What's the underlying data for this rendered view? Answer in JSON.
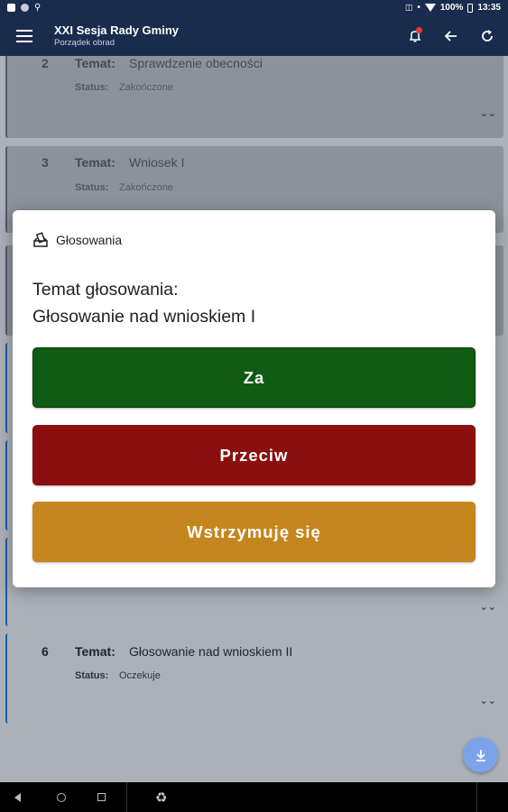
{
  "status_bar": {
    "battery": "100%",
    "time": "13:35"
  },
  "app_bar": {
    "title": "XXI Sesja Rady Gminy",
    "subtitle": "Porządek obrad",
    "icons": [
      "menu-icon",
      "notifications-icon",
      "back-arrow-icon",
      "refresh-icon"
    ]
  },
  "agenda": {
    "items": [
      {
        "number": "2",
        "topic_label": "Temat:",
        "topic": "Sprawdzenie obecności",
        "status_label": "Status:",
        "status": "Zakończone"
      },
      {
        "number": "3",
        "topic_label": "Temat:",
        "topic": "Wniosek I",
        "status_label": "Status:",
        "status": "Zakończone"
      },
      {
        "number": "6",
        "topic_label": "Temat:",
        "topic": "Głosowanie nad wnioskiem II",
        "status_label": "Status:",
        "status": "Oczekuje"
      }
    ]
  },
  "dialog": {
    "title": "Głosowania",
    "question_label": "Temat głosowania:",
    "question": "Głosowanie nad wnioskiem I",
    "buttons": {
      "yes": "Za",
      "no": "Przeciw",
      "abstain": "Wstrzymuję się"
    },
    "colors": {
      "yes": "#0f5b14",
      "no": "#8a0f0f",
      "abstain": "#c6861f"
    }
  },
  "colors": {
    "app_bar": "#1a2c4d",
    "accent_stripe": "#1e63b8",
    "fab": "#7ba4e8"
  }
}
